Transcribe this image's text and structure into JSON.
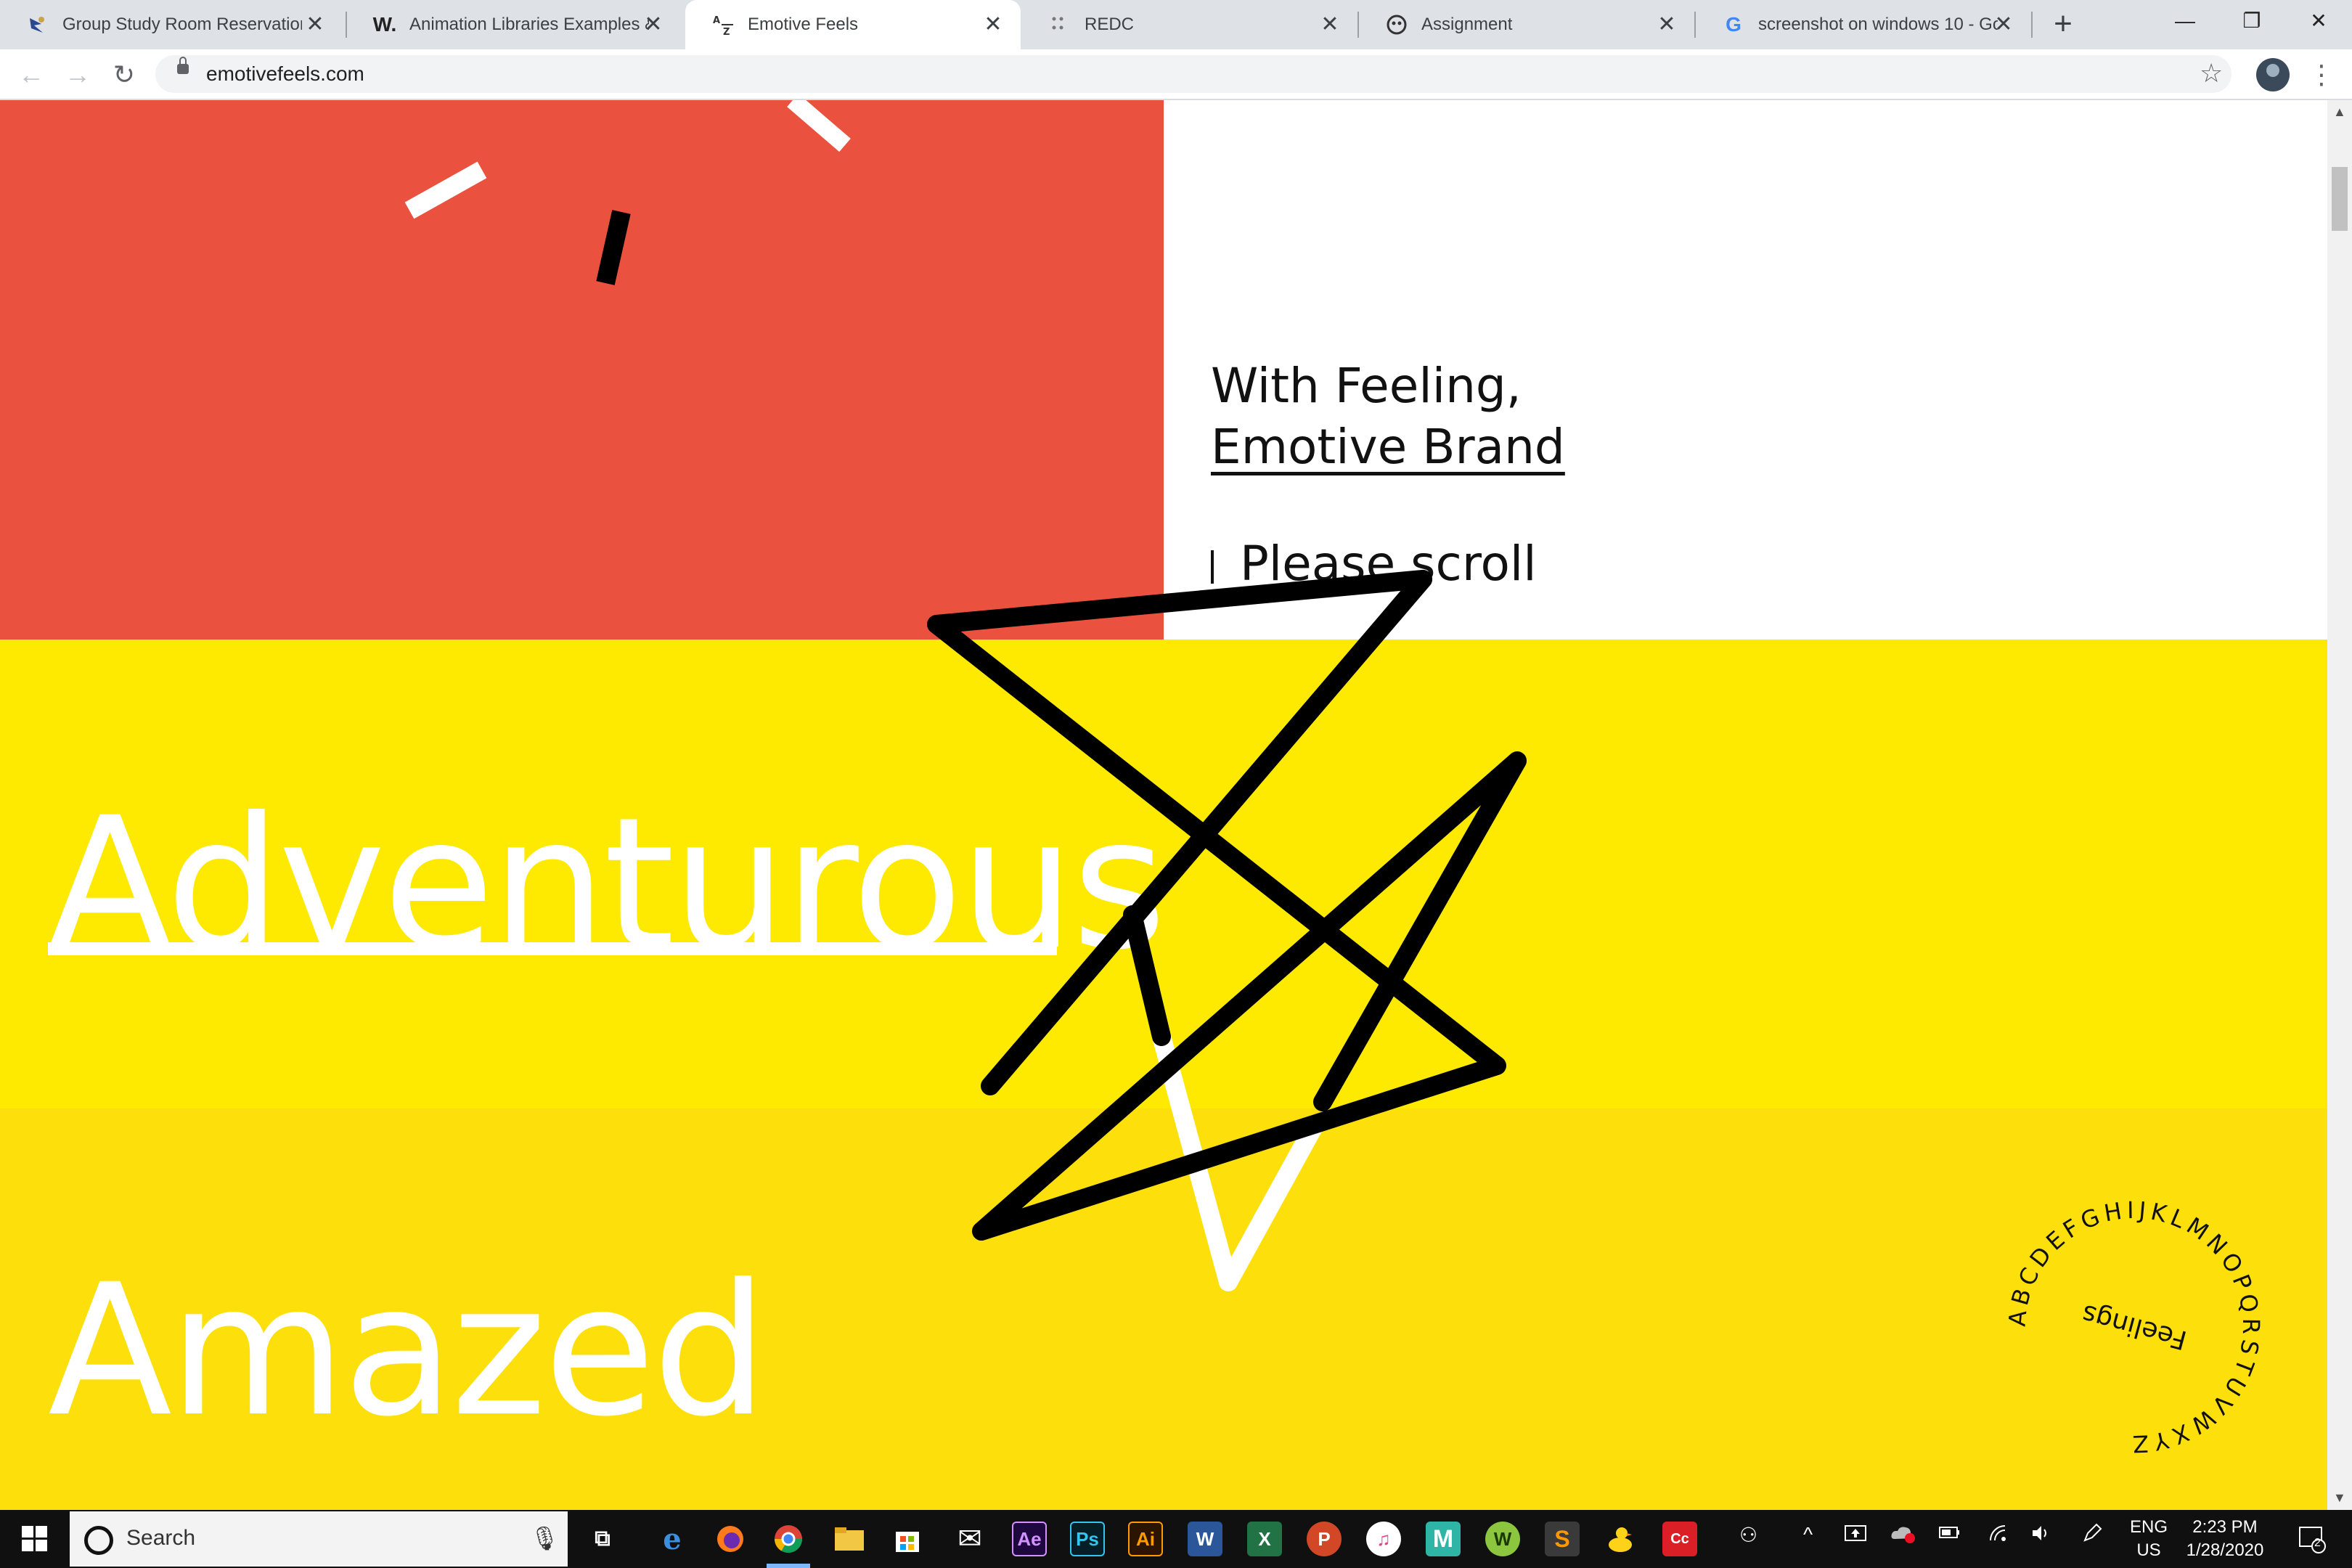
{
  "browser": {
    "tabs": [
      {
        "title": "Group Study Room Reservation",
        "icon": "mascot-bird-icon"
      },
      {
        "title": "Animation Libraries Examples &",
        "icon": "w-logo-icon"
      },
      {
        "title": "Emotive Feels",
        "icon": "az-sort-icon",
        "active": true
      },
      {
        "title": "REDC",
        "icon": "dotted-grid-icon"
      },
      {
        "title": "Assignment",
        "icon": "game-controller-icon"
      },
      {
        "title": "screenshot on windows 10 - Go",
        "icon": "google-g-icon"
      }
    ],
    "tab_favicons": {
      "w": "W.",
      "az": "AZ",
      "google": "G"
    },
    "new_tab": "+",
    "close_glyph": "✕",
    "window_controls": {
      "minimize": "—",
      "restore": "❐",
      "close": "✕"
    },
    "nav": {
      "back": "←",
      "forward": "→",
      "reload": "↻"
    },
    "url": "emotivefeels.com",
    "bookmark_star": "☆",
    "menu": "⋮"
  },
  "page": {
    "headline_line1": "With Feeling,",
    "headline_line2": "Emotive Brand",
    "scroll_hint": "Please scroll",
    "word_1": "Adventurous",
    "word_2": "Amazed",
    "badge_center": "Feelings",
    "badge_ring": "ABCDEFGHIJKLMNOPQRSTUVWXYZ",
    "colors": {
      "red": "#ea513e",
      "yellow": "#feea00",
      "yellow_dark": "#fddf0c",
      "white": "#ffffff",
      "ink": "#000000"
    }
  },
  "taskbar": {
    "search_placeholder": "Search",
    "mic": "🎙",
    "apps": [
      {
        "name": "task-view-icon",
        "label": "⧉"
      },
      {
        "name": "edge-icon",
        "label": "e"
      },
      {
        "name": "firefox-icon",
        "label": ""
      },
      {
        "name": "chrome-icon",
        "label": ""
      },
      {
        "name": "file-explorer-icon",
        "label": ""
      },
      {
        "name": "store-icon",
        "label": ""
      },
      {
        "name": "mail-icon",
        "label": "✉"
      },
      {
        "name": "after-effects-icon",
        "label": "Ae"
      },
      {
        "name": "photoshop-icon",
        "label": "Ps"
      },
      {
        "name": "illustrator-icon",
        "label": "Ai"
      },
      {
        "name": "word-icon",
        "label": "W"
      },
      {
        "name": "excel-icon",
        "label": "X"
      },
      {
        "name": "powerpoint-icon",
        "label": "P"
      },
      {
        "name": "itunes-icon",
        "label": "♫"
      },
      {
        "name": "m-app-icon",
        "label": "M"
      },
      {
        "name": "w-app-icon",
        "label": "W"
      },
      {
        "name": "sublime-icon",
        "label": "S"
      },
      {
        "name": "duck-icon",
        "label": ""
      },
      {
        "name": "creative-cloud-icon",
        "label": "Cc"
      }
    ],
    "tray": {
      "people": "⚇",
      "chevron": "^",
      "language_1": "ENG",
      "language_2": "US",
      "time": "2:23 PM",
      "date": "1/28/2020",
      "notifications": "2"
    }
  }
}
